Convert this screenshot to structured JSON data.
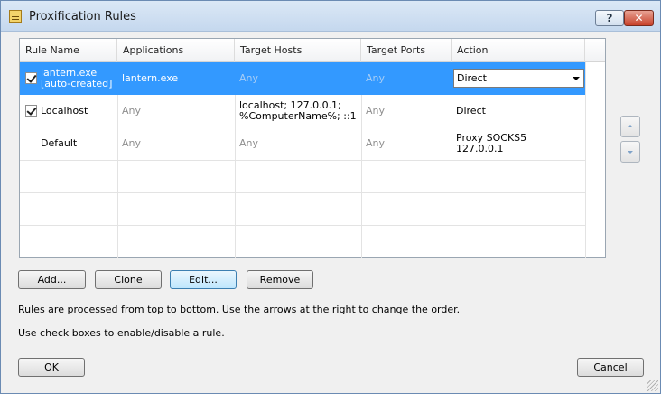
{
  "window": {
    "title": "Proxification Rules",
    "help_label": "?",
    "close_label": "✕"
  },
  "table": {
    "headers": [
      "Rule Name",
      "Applications",
      "Target Hosts",
      "Target Ports",
      "Action"
    ],
    "rows": [
      {
        "checked": true,
        "name": "lantern.exe",
        "name_sub": "[auto-created]",
        "applications": "lantern.exe",
        "target_hosts": "Any",
        "target_hosts_2": "",
        "target_ports": "Any",
        "action": "Direct",
        "action_2": "",
        "selected": true
      },
      {
        "checked": true,
        "name": "Localhost",
        "name_sub": "",
        "applications": "Any",
        "target_hosts": "localhost; 127.0.0.1;",
        "target_hosts_2": "%ComputerName%; ::1",
        "target_ports": "Any",
        "action": "Direct",
        "action_2": "",
        "selected": false
      },
      {
        "checked": false,
        "name": "Default",
        "name_sub": "",
        "applications": "Any",
        "target_hosts": "Any",
        "target_hosts_2": "",
        "target_ports": "Any",
        "action": "Proxy SOCKS5",
        "action_2": "127.0.0.1",
        "selected": false
      }
    ]
  },
  "buttons": {
    "add": "Add...",
    "clone": "Clone",
    "edit": "Edit...",
    "remove": "Remove",
    "ok": "OK",
    "cancel": "Cancel"
  },
  "info": {
    "line1": "Rules are processed from top to bottom. Use the arrows at the right to change the order.",
    "line2": "Use check boxes to enable/disable a rule."
  },
  "colors": {
    "selection": "#3399ff",
    "window_bg": "#f0f0f0"
  }
}
